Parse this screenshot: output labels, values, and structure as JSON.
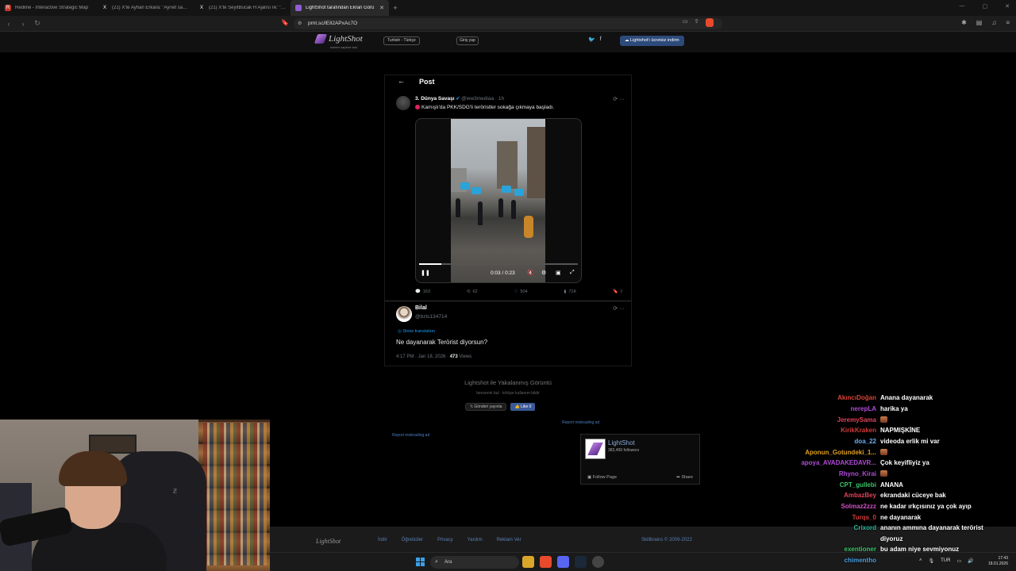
{
  "browser": {
    "tabs": [
      {
        "title": "Redline - Interactive Strategic Map",
        "fav_color": "#c0392b",
        "fav": "R"
      },
      {
        "title": "(21) X'te Ayhan Erkara: \"Ayrıet savaş",
        "fav_color": "#000000",
        "fav": "X"
      },
      {
        "title": "(21) X'te SeyitBucak H Ajansı re: \"Suri",
        "fav_color": "#000000",
        "fav": "X"
      },
      {
        "title": "LightShot tarafından Ekran Görü",
        "fav_color": "#8e5fd0",
        "fav": "L"
      }
    ],
    "new_tab": "+",
    "url": "prnt.sc/lEIl2APxAc7O"
  },
  "lightshot": {
    "logo": "LightShot",
    "tagline": "screen capture tool",
    "language": "Turkish - Türkçe",
    "login": "Giriş yap",
    "download": "Lightshot'ı ücretsiz indirin",
    "caption": "Lightshot ile Yakalanmış Görüntü",
    "sublinks": "benzerini bul · kötüye kullanım bildir",
    "tweet_button": "Gönderi yayınla",
    "like_button": "Like 0",
    "report_ad": "Report misleading ad",
    "fb_page": "LightShot",
    "fb_followers": "383,499 followers",
    "fb_follow": "Follow Page",
    "fb_share": "Share",
    "footer_logo": "LightShot",
    "footer_links": [
      "İndir",
      "Öğreticiler",
      "Privacy",
      "Yardım",
      "Reklam Ver"
    ],
    "footer_brand": "Skillbrains",
    "footer_copy": " © 2009-2022"
  },
  "post": {
    "header": "Post",
    "tweet1": {
      "author": "3. Dünya Savaşı",
      "handle": "@ww3mediaa · 1h",
      "text": "Kamışlı'da PKK/SDG'li teröristler sokağa çıkmaya başladı.",
      "video_time": "0:03 / 0:23",
      "video_progress": 0.14,
      "replies": "163",
      "reposts": "62",
      "likes": "504",
      "views": "71K"
    },
    "tweet2": {
      "author": "Bilal",
      "handle": "@bzts134714",
      "show_translation": "Show translation",
      "text": "Ne dayanarak Terörist diyorsun?",
      "meta": "4:17 PM · Jan 18, 2026 · ",
      "views_count": "473",
      "views_label": " Views"
    }
  },
  "chat": [
    {
      "user": "AkıncıDoğan",
      "text": "Anana dayanarak",
      "color": "#d8443a"
    },
    {
      "user": "nerepLA",
      "text": "harika ya",
      "color": "#b04bd8"
    },
    {
      "user": "JeremySama",
      "text": "",
      "color": "#e0435b",
      "emote": true
    },
    {
      "user": "KirikKraken",
      "text": "NAPMIŞKİNE",
      "color": "#d23a3a"
    },
    {
      "user": "doa_22",
      "text": "videoda erlik mi var",
      "color": "#6ab0f5"
    },
    {
      "user": "Aponun_Gotundeki_1...",
      "text": "",
      "color": "#e0a020",
      "emote": true
    },
    {
      "user": "apoya_AVADAKEDAVR...",
      "text": "Çok keyifliyiz ya",
      "color": "#b04bd8"
    },
    {
      "user": "Rhyno_Kirai",
      "text": "",
      "color": "#b04bd8",
      "emote": true
    },
    {
      "user": "CPT_gullebi",
      "text": "ANANA",
      "color": "#3cc46a"
    },
    {
      "user": "AmbazBey",
      "text": "ekrandaki cüceye bak",
      "color": "#e0435b"
    },
    {
      "user": "Solmaz2zzz",
      "text": "ne kadar ırkçısınız ya çok ayıp",
      "color": "#d052c8"
    },
    {
      "user": "Turqs_0",
      "text": "ne dayanarak",
      "color": "#d23a3a"
    },
    {
      "user": "Crixord",
      "text": "ananın ammına dayanarak terörist",
      "color": "#2bb39a"
    },
    {
      "user": "",
      "text": "diyoruz",
      "color": "#ffffff"
    },
    {
      "user": "exentioner",
      "text": " bu adam niye sevmiyonuz",
      "color": "#3cc46a"
    },
    {
      "user": "chimentho",
      "text": "",
      "color": "#4aa0e0"
    }
  ],
  "taskbar": {
    "search": "Ara",
    "lang": "TUR",
    "time": "17:43",
    "date": "18.01.2026"
  }
}
